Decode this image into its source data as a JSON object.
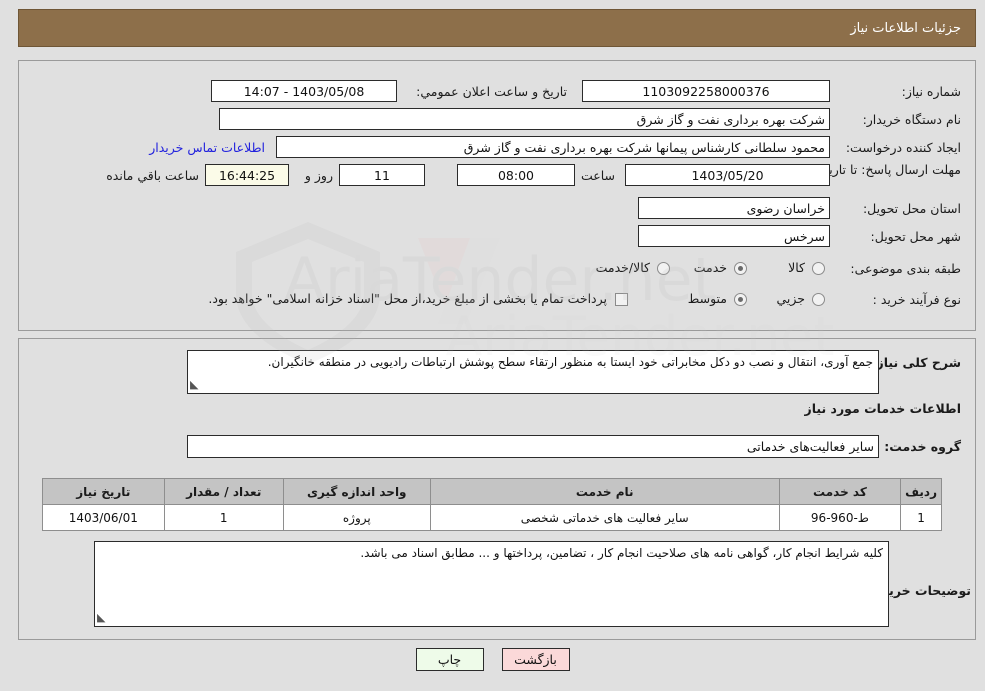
{
  "header": {
    "title": "جزئیات اطلاعات نیاز"
  },
  "main": {
    "need_number": {
      "label": "شماره نیاز:",
      "value": "1103092258000376"
    },
    "buyer_org": {
      "label": "نام دستگاه خریدار:",
      "value": "شرکت بهره برداری نفت و گاز شرق"
    },
    "creator": {
      "label": "ایجاد کننده درخواست:",
      "value": "محمود سلطانی کارشناس پیمانها شرکت بهره برداری نفت و گاز شرق"
    },
    "buyer_contact_link": "اطلاعات تماس خریدار",
    "deadline": {
      "label": "مهلت ارسال پاسخ: تا تاریخ:",
      "date": "1403/05/20",
      "hour_label": "ساعت",
      "hour": "08:00",
      "days": "11",
      "days_suffix": "روز و",
      "countdown": "16:44:25",
      "countdown_suffix": "ساعت باقي مانده"
    },
    "announce": {
      "label": "تاریخ و ساعت اعلان عمومي:",
      "value": "1403/05/08 - 14:07"
    },
    "province": {
      "label": "استان محل تحویل:",
      "value": "خراسان رضوی"
    },
    "city": {
      "label": "شهر محل تحویل:",
      "value": "سرخس"
    },
    "category": {
      "label": "طبقه بندی موضوعی:",
      "options": [
        {
          "label": "کالا",
          "selected": false
        },
        {
          "label": "خدمت",
          "selected": true
        },
        {
          "label": "کالا/خدمت",
          "selected": false
        }
      ]
    },
    "purchase_process": {
      "label": "نوع فرآیند خرید :",
      "options": [
        {
          "label": "جزیي",
          "selected": false
        },
        {
          "label": "متوسط",
          "selected": true
        }
      ],
      "checkbox_label": "پرداخت تمام یا بخشی از مبلغ خرید،از محل \"اسناد خزانه اسلامی\" خواهد بود.",
      "checkbox_checked": false
    }
  },
  "description": {
    "need_summary_label": "شرح کلی نیاز:",
    "need_summary_value": "جمع آوری، انتقال و نصب دو دکل مخابراتی خود ایستا به منظور ارتقاء سطح پوشش ارتباطات رادیویی در منطقه خانگیران.",
    "services_info_heading": "اطلاعات خدمات مورد نیاز",
    "service_group_label": "گروه خدمت:",
    "service_group_value": "سایر فعالیت‌های خدماتی",
    "buyer_notes_label": "توضیحات خریدار:",
    "buyer_notes_value": "کلیه شرایط انجام کار، گواهی نامه های صلاحیت انجام کار ، تضامین، پرداختها و ... مطابق اسناد می باشد."
  },
  "table": {
    "columns": [
      "ردیف",
      "کد خدمت",
      "نام خدمت",
      "واحد اندازه گیری",
      "تعداد / مقدار",
      "تاریخ نیاز"
    ],
    "rows": [
      {
        "row": "1",
        "code": "ط-960-96",
        "name": "سایر فعالیت های خدماتی شخصی",
        "unit": "پروژه",
        "qty": "1",
        "date": "1403/06/01"
      }
    ]
  },
  "buttons": {
    "print": "چاپ",
    "back": "بازگشت"
  },
  "watermark": {
    "text": "AriaTender.net"
  },
  "colors": {
    "header_bg": "#8d6f4a",
    "page_bg": "#e0e0e0",
    "link": "#2222dd",
    "countdown_bg": "#fbfbe8",
    "print_btn": "#eefbe9",
    "back_btn": "#fbd9d9"
  }
}
